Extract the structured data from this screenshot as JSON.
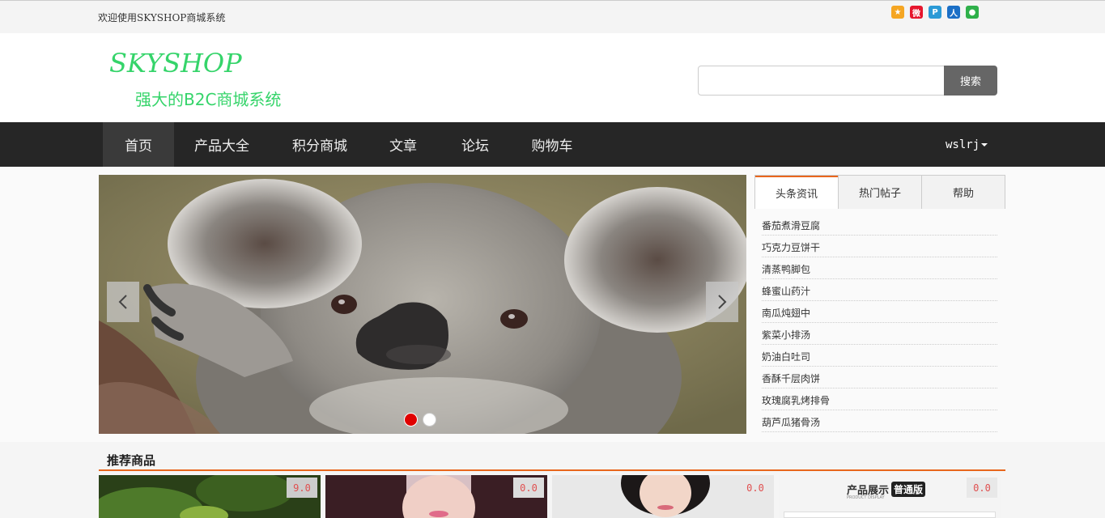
{
  "topbar": {
    "welcome": "欢迎使用SKYSHOP商城系统",
    "shares": [
      {
        "name": "qzone-icon",
        "glyph": "★",
        "color": "#f5a623"
      },
      {
        "name": "weibo-icon",
        "glyph": "微",
        "color": "#e6162d"
      },
      {
        "name": "tencent-weibo-icon",
        "glyph": "P",
        "color": "#2b9ad6"
      },
      {
        "name": "renren-icon",
        "glyph": "人",
        "color": "#1b6fc6"
      },
      {
        "name": "wechat-icon",
        "glyph": "●",
        "color": "#2fb04a"
      }
    ]
  },
  "header": {
    "logo": "SKYSHOP",
    "slogan": "强大的B2C商城系统",
    "search_placeholder": "",
    "search_button": "搜索"
  },
  "nav": {
    "items": [
      "首页",
      "产品大全",
      "积分商城",
      "文章",
      "论坛",
      "购物车"
    ],
    "active_index": 0,
    "user": "wslrj"
  },
  "carousel": {
    "slide_count": 2,
    "active_slide": 0,
    "active_dot_color": "#e00000"
  },
  "news": {
    "tabs": [
      "头条资讯",
      "热门帖子",
      "帮助"
    ],
    "active_tab": 0,
    "items": [
      "番茄煮滑豆腐",
      "巧克力豆饼干",
      "清蒸鸭脚包",
      "蜂蜜山药汁",
      "南瓜炖翅中",
      "紫菜小排汤",
      "奶油白吐司",
      "香酥千层肉饼",
      "玫瑰腐乳烤排骨",
      "葫芦瓜猪骨汤"
    ]
  },
  "recommended": {
    "title": "推荐商品",
    "products": [
      {
        "price": "9.0"
      },
      {
        "price": "0.0"
      },
      {
        "price": "0.0"
      },
      {
        "price": "0.0",
        "image_text": "产品展示",
        "badge": "普通版",
        "caption": "PRODUCT DISPLAY"
      }
    ]
  },
  "colors": {
    "accent": "#e8661c",
    "logo_green": "#35d46a",
    "nav_bg": "#262626"
  }
}
